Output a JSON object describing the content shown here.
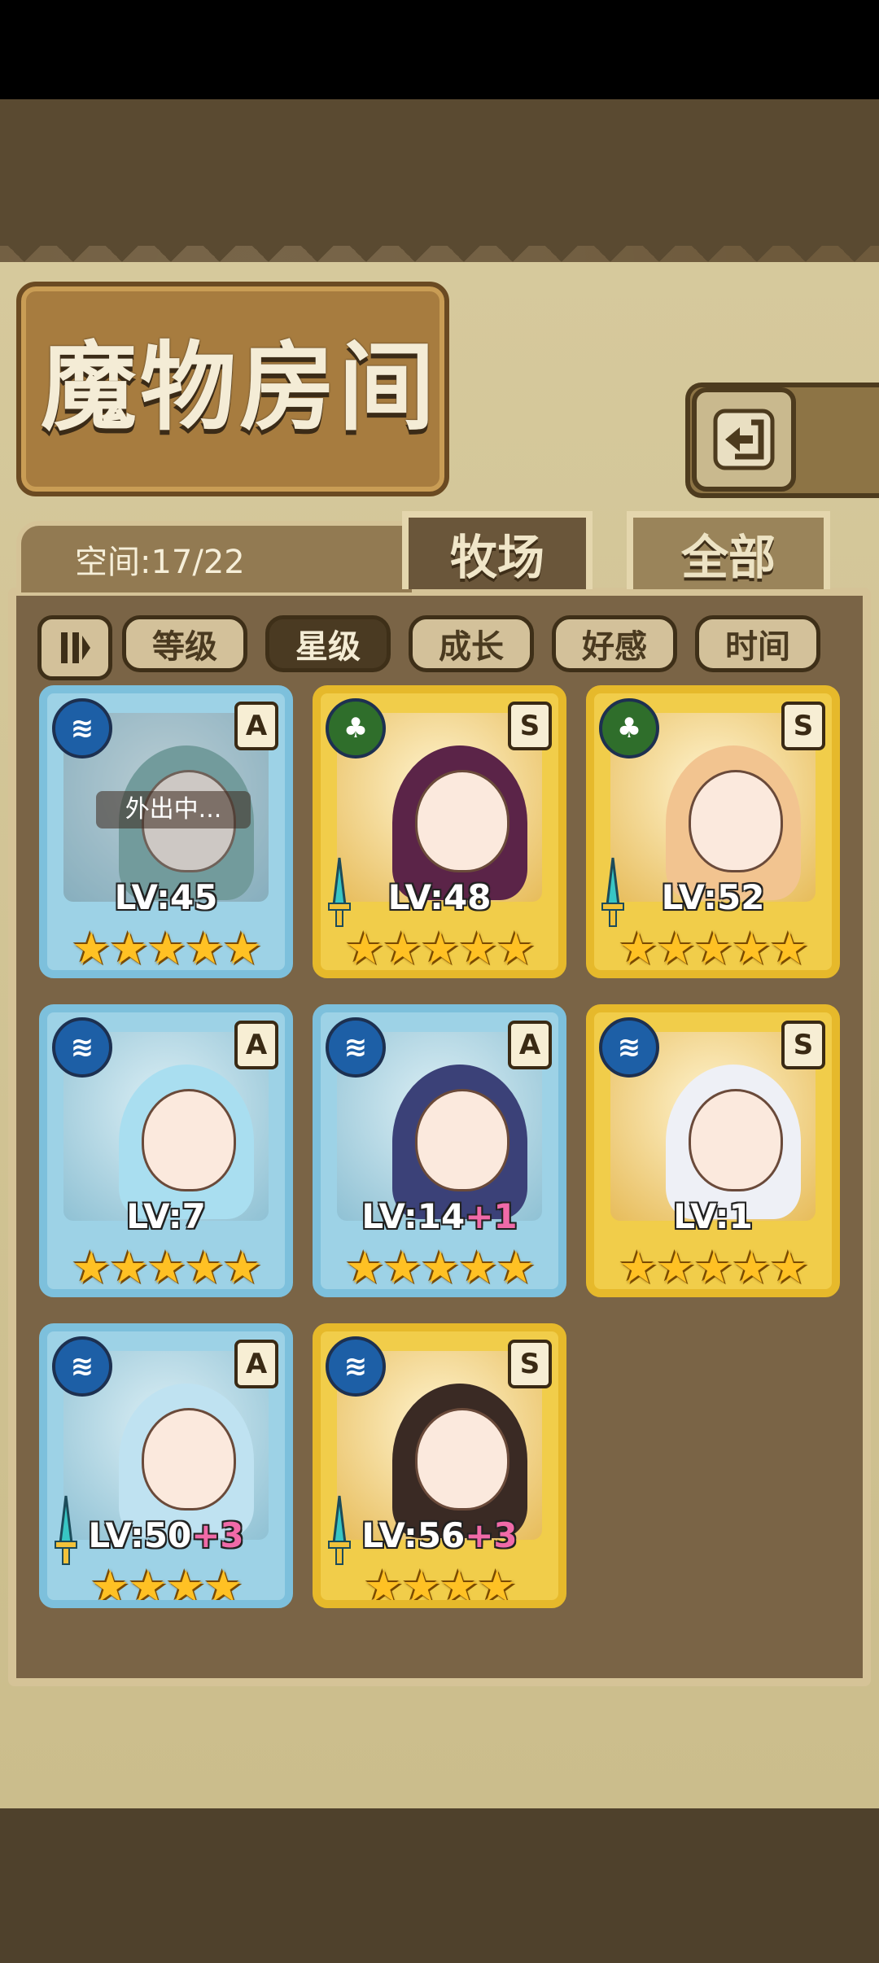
{
  "window": {
    "title": "魔物房间"
  },
  "header": {
    "back_icon": "back-arrow-icon"
  },
  "tabs": [
    {
      "label": "牧场",
      "active": true
    },
    {
      "label": "全部",
      "active": false
    }
  ],
  "space": {
    "label": "空间:17/22"
  },
  "sort": {
    "toggle_icon": "sort-order-icon",
    "buttons": [
      {
        "label": "等级",
        "active": false
      },
      {
        "label": "星级",
        "active": true
      },
      {
        "label": "成长",
        "active": false
      },
      {
        "label": "好感",
        "active": false
      },
      {
        "label": "时间",
        "active": false
      }
    ]
  },
  "monsters": [
    {
      "element": "water",
      "rank": "A",
      "level": "LV:45",
      "bonus": "",
      "stars": "★★★★★",
      "status": "外出中..."
    },
    {
      "element": "leaf",
      "rank": "S",
      "level": "LV:48",
      "bonus": "",
      "stars": "★★★★★",
      "status": ""
    },
    {
      "element": "leaf",
      "rank": "S",
      "level": "LV:52",
      "bonus": "",
      "stars": "★★★★★",
      "status": ""
    },
    {
      "element": "water",
      "rank": "A",
      "level": "LV:7",
      "bonus": "",
      "stars": "★★★★★",
      "status": ""
    },
    {
      "element": "water",
      "rank": "A",
      "level": "LV:14",
      "bonus": "+1",
      "stars": "★★★★★",
      "status": ""
    },
    {
      "element": "water",
      "rank": "S",
      "level": "LV:1",
      "bonus": "",
      "stars": "★★★★★",
      "status": ""
    },
    {
      "element": "water",
      "rank": "A",
      "level": "LV:50",
      "bonus": "+3",
      "stars": "★★★★",
      "status": ""
    },
    {
      "element": "water",
      "rank": "S",
      "level": "LV:56",
      "bonus": "+3",
      "stars": "★★★★",
      "status": ""
    }
  ],
  "colors": {
    "blue_frame": "#7dc0dc",
    "gold_frame": "#e6b92b",
    "active_sort": "#4a3a22"
  }
}
